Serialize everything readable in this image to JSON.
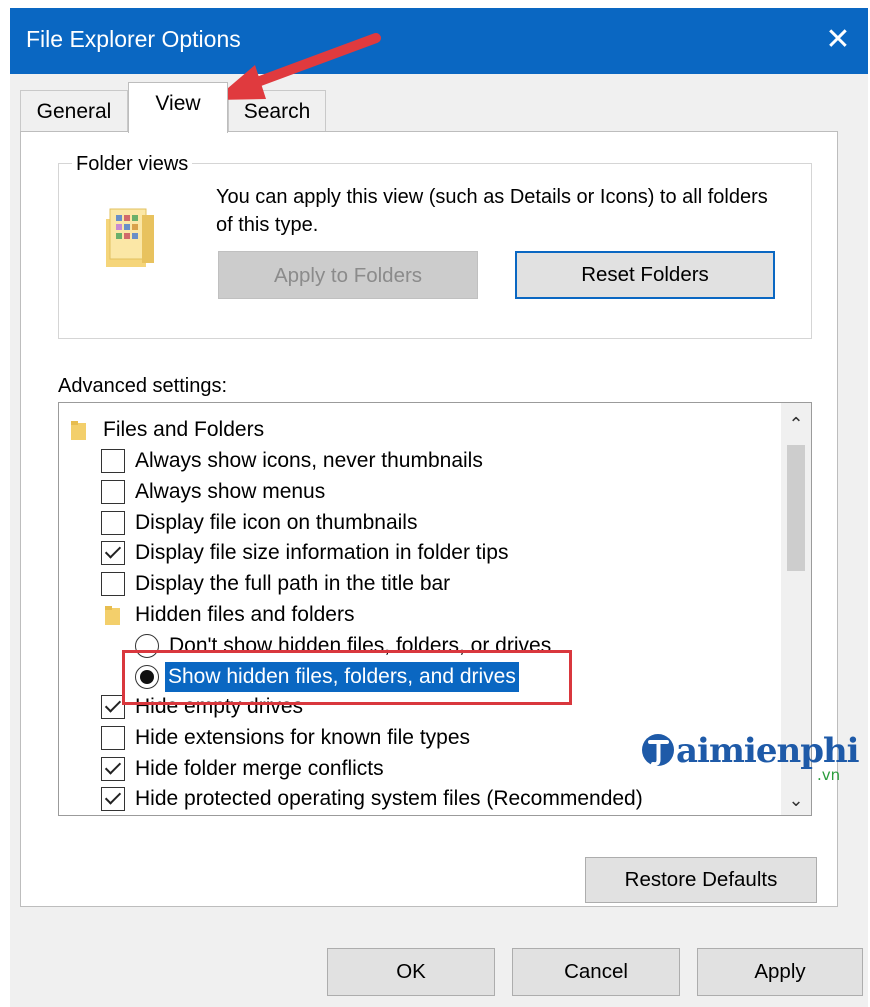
{
  "window": {
    "title": "File Explorer Options",
    "close_symbol": "✕"
  },
  "tabs": [
    {
      "label": "General",
      "active": false
    },
    {
      "label": "View",
      "active": true
    },
    {
      "label": "Search",
      "active": false
    }
  ],
  "folder_views": {
    "legend": "Folder views",
    "description": "You can apply this view (such as Details or Icons) to all folders of this type.",
    "apply_button": "Apply to Folders",
    "apply_button_enabled": false,
    "reset_button": "Reset Folders"
  },
  "advanced": {
    "label": "Advanced settings:",
    "items": [
      {
        "kind": "folder",
        "label": "Files and Folders"
      },
      {
        "kind": "checkbox",
        "label": "Always show icons, never thumbnails",
        "checked": false
      },
      {
        "kind": "checkbox",
        "label": "Always show menus",
        "checked": false
      },
      {
        "kind": "checkbox",
        "label": "Display file icon on thumbnails",
        "checked": false
      },
      {
        "kind": "checkbox",
        "label": "Display file size information in folder tips",
        "checked": true
      },
      {
        "kind": "checkbox",
        "label": "Display the full path in the title bar",
        "checked": false
      },
      {
        "kind": "folder",
        "label": "Hidden files and folders"
      },
      {
        "kind": "radio",
        "label": "Don't show hidden files, folders, or drives",
        "selected": false
      },
      {
        "kind": "radio",
        "label": "Show hidden files, folders, and drives",
        "selected": true
      },
      {
        "kind": "checkbox",
        "label": "Hide empty drives",
        "checked": true
      },
      {
        "kind": "checkbox",
        "label": "Hide extensions for known file types",
        "checked": false
      },
      {
        "kind": "checkbox",
        "label": "Hide folder merge conflicts",
        "checked": true
      },
      {
        "kind": "checkbox",
        "label": "Hide protected operating system files (Recommended)",
        "checked": true
      }
    ]
  },
  "scrollbar": {
    "up_icon": "chevron-up-icon",
    "down_icon": "chevron-down-icon",
    "up_symbol": "⌃",
    "down_symbol": "⌄"
  },
  "restore_button": "Restore Defaults",
  "footer": {
    "ok": "OK",
    "cancel": "Cancel",
    "apply": "Apply"
  },
  "watermark": {
    "brand": "aimienphi",
    "suffix": ".vn"
  },
  "colors": {
    "accent": "#0a67c2",
    "highlight": "#d9373d",
    "arrow": "#e03a3e"
  }
}
